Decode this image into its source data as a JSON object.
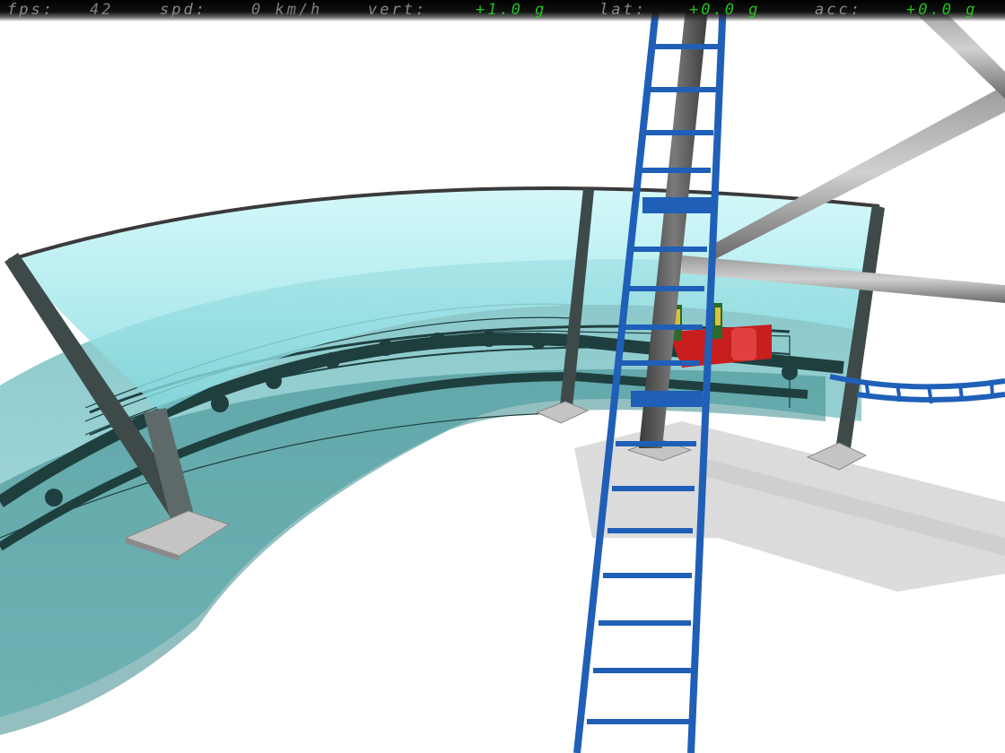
{
  "hud": {
    "fps_label": "fps:",
    "fps_value": "42",
    "spd_label": "spd:",
    "spd_value": "0 km/h",
    "vert_label": "vert:",
    "vert_value": "+1.0 g",
    "lat_label": "lat:",
    "lat_value": "+0.0 g",
    "acc_label": "acc:",
    "acc_value": "+0.0 g"
  },
  "colors": {
    "hud_bg": "#000000",
    "hud_label": "#8a8a8a",
    "hud_value": "#7f7f7f",
    "hud_green": "#22c21e",
    "track_blue": "#1f5fb8",
    "glass": "#9fe6ea",
    "pole_gray": "#5a5a5a",
    "train_red": "#c81e1e",
    "station_dark": "#1f3f3f"
  }
}
